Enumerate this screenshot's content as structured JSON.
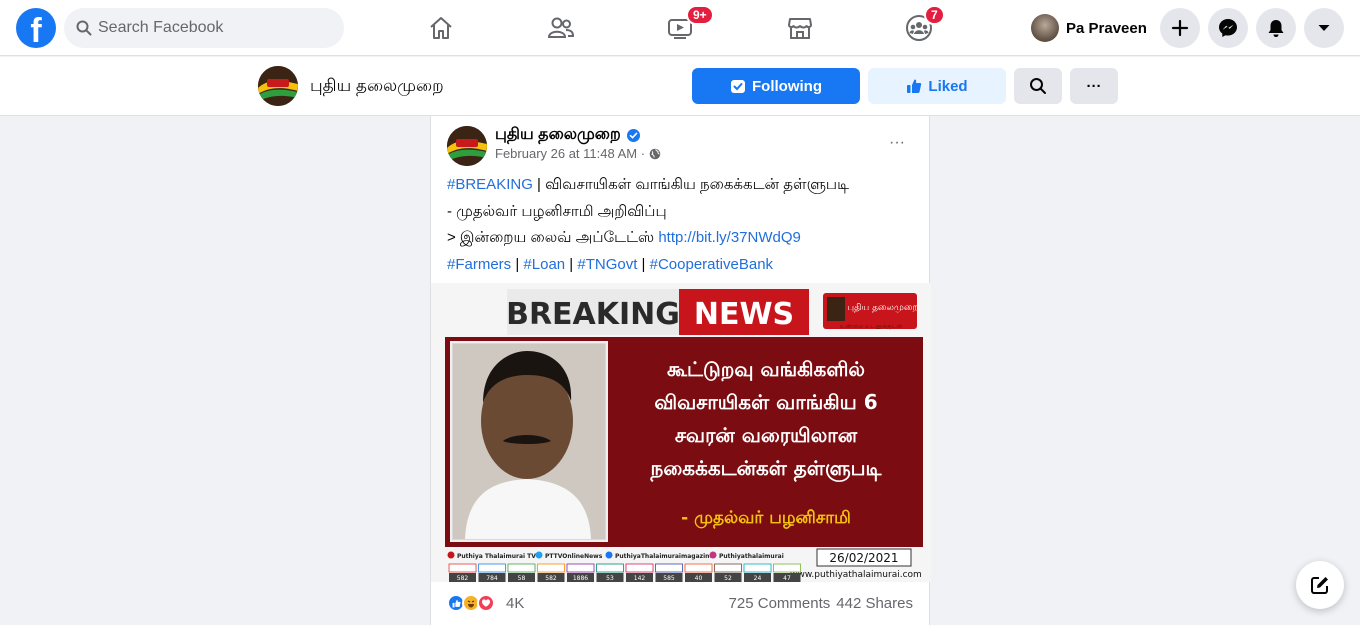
{
  "topnav": {
    "logo": "f",
    "search_placeholder": "Search Facebook",
    "icons": [
      "home-icon",
      "friends-icon",
      "watch-icon",
      "marketplace-icon",
      "groups-icon"
    ],
    "watch_badge": "9+",
    "groups_badge": "7",
    "profile_name": "Pa Praveen",
    "right_icons": [
      "plus-icon",
      "messenger-icon",
      "notifications-icon",
      "account-menu-icon"
    ]
  },
  "page_header": {
    "name": "புதிய தலைமுறை",
    "following_label": "Following",
    "liked_label": "Liked",
    "more_label": "···"
  },
  "post": {
    "author": "புதிய தலைமுறை",
    "timestamp": "February 26 at 11:48 AM ·",
    "options_label": "···",
    "hashtag_breaking": "#BREAKING",
    "line1_rest": " | விவசாயிகள் வாங்கிய நகைக்கடன் தள்ளுபடி",
    "line2": "- முதல்வர் பழனிசாமி அறிவிப்பு",
    "line3_prefix": "> இன்றைய லைவ் அப்டேட்ஸ் ",
    "link": "http://bit.ly/37NWdQ9",
    "tags": [
      "#Farmers",
      "#Loan",
      "#TNGovt",
      "#CooperativeBank"
    ],
    "reaction_count": "4K",
    "comments": "725 Comments",
    "shares": "442 Shares"
  },
  "post_image": {
    "breaking": "BREAKING",
    "news": "NEWS",
    "brand": "புதிய தலைமுறை",
    "brand_tag": "உண்மை உடனுக்குடன்",
    "headline": [
      "கூட்டுறவு வங்கிகளில்",
      "விவசாயிகள் வாங்கிய 6",
      "சவரன் வரையிலான",
      "நகைக்கடன்கள் தள்ளுபடி"
    ],
    "byline": "- முதல்வர் பழனிசாமி",
    "social": [
      "Puthiya Thalaimurai TV",
      "PTTVOnlineNews",
      "PuthiyaThalaimuraimagazine",
      "Puthiyathalaimurai"
    ],
    "date": "26/02/2021",
    "website": "www.puthiyathalaimurai.com",
    "channel_numbers": [
      "582",
      "784",
      "58",
      "582",
      "1886",
      "53",
      "142",
      "585",
      "40",
      "52",
      "24",
      "47"
    ]
  },
  "colors": {
    "brand_blue": "#1877f2",
    "badge_red": "#e41e3f",
    "news_red": "#c8141b",
    "headline_bg": "#7a0c12"
  }
}
